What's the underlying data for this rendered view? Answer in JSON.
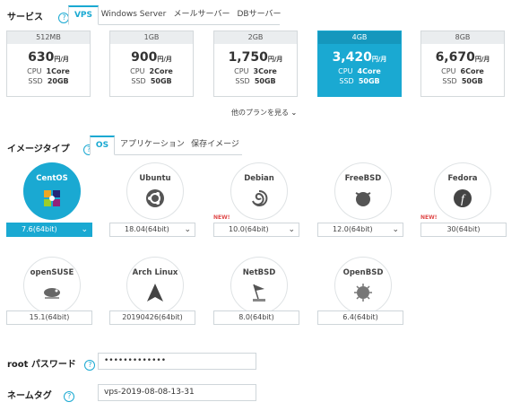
{
  "service": {
    "label": "サービス",
    "help": "?",
    "tabs": [
      "VPS",
      "Windows Server",
      "メールサーバー",
      "DBサーバー"
    ],
    "active_tab": "VPS"
  },
  "plans": [
    {
      "memory": "512MB",
      "price": "630",
      "unit": "円/月",
      "cpu_label": "CPU",
      "cpu": "1Core",
      "ssd_label": "SSD",
      "ssd": "20GB",
      "selected": false
    },
    {
      "memory": "1GB",
      "price": "900",
      "unit": "円/月",
      "cpu_label": "CPU",
      "cpu": "2Core",
      "ssd_label": "SSD",
      "ssd": "50GB",
      "selected": false
    },
    {
      "memory": "2GB",
      "price": "1,750",
      "unit": "円/月",
      "cpu_label": "CPU",
      "cpu": "3Core",
      "ssd_label": "SSD",
      "ssd": "50GB",
      "selected": false
    },
    {
      "memory": "4GB",
      "price": "3,420",
      "unit": "円/月",
      "cpu_label": "CPU",
      "cpu": "4Core",
      "ssd_label": "SSD",
      "ssd": "50GB",
      "selected": true
    },
    {
      "memory": "8GB",
      "price": "6,670",
      "unit": "円/月",
      "cpu_label": "CPU",
      "cpu": "6Core",
      "ssd_label": "SSD",
      "ssd": "50GB",
      "selected": false
    }
  ],
  "more_plans": "他のプランを見る",
  "image_type": {
    "label": "イメージタイプ",
    "help": "?",
    "tabs": [
      "OS",
      "アプリケーション",
      "保存イメージ"
    ],
    "active_tab": "OS"
  },
  "os_list": [
    {
      "name": "CentOS",
      "version": "7.6(64bit)",
      "dropdown": true,
      "selected": true,
      "new": false,
      "icon": "centos-logo-icon"
    },
    {
      "name": "Ubuntu",
      "version": "18.04(64bit)",
      "dropdown": true,
      "selected": false,
      "new": false,
      "icon": "ubuntu-logo-icon"
    },
    {
      "name": "Debian",
      "version": "10.0(64bit)",
      "dropdown": true,
      "selected": false,
      "new": true,
      "icon": "debian-logo-icon"
    },
    {
      "name": "FreeBSD",
      "version": "12.0(64bit)",
      "dropdown": true,
      "selected": false,
      "new": false,
      "icon": "freebsd-logo-icon"
    },
    {
      "name": "Fedora",
      "version": "30(64bit)",
      "dropdown": false,
      "selected": false,
      "new": true,
      "icon": "fedora-logo-icon"
    },
    {
      "name": "openSUSE",
      "version": "15.1(64bit)",
      "dropdown": false,
      "selected": false,
      "new": false,
      "icon": "opensuse-logo-icon"
    },
    {
      "name": "Arch Linux",
      "version": "20190426(64bit)",
      "dropdown": false,
      "selected": false,
      "new": false,
      "icon": "archlinux-logo-icon"
    },
    {
      "name": "NetBSD",
      "version": "8.0(64bit)",
      "dropdown": false,
      "selected": false,
      "new": false,
      "icon": "netbsd-logo-icon"
    },
    {
      "name": "OpenBSD",
      "version": "6.4(64bit)",
      "dropdown": false,
      "selected": false,
      "new": false,
      "icon": "openbsd-logo-icon"
    }
  ],
  "new_badge": "NEW!",
  "root_password": {
    "label": "root パスワード",
    "help": "?",
    "value": "•••••••••••••"
  },
  "name_tag": {
    "label": "ネームタグ",
    "help": "?",
    "value": "vps-2019-08-08-13-31"
  },
  "colors": {
    "accent": "#1aa9d2",
    "new_badge": "#e04a4a"
  }
}
